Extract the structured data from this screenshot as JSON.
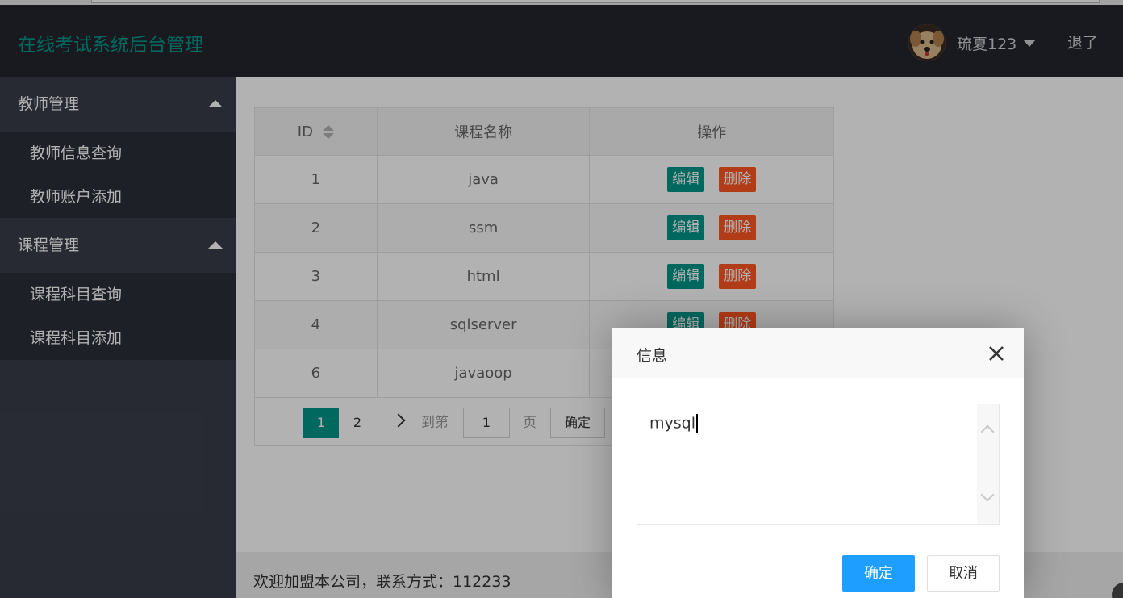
{
  "header": {
    "logo": "在线考试系统后台管理",
    "username": "琉夏123",
    "logout": "退了"
  },
  "sidebar": {
    "groups": [
      {
        "title": "教师管理",
        "items": [
          "教师信息查询",
          "教师账户添加"
        ]
      },
      {
        "title": "课程管理",
        "items": [
          "课程科目查询",
          "课程科目添加"
        ]
      }
    ]
  },
  "table": {
    "columns": [
      "ID",
      "课程名称",
      "操作"
    ],
    "rows": [
      {
        "id": "1",
        "name": "java"
      },
      {
        "id": "2",
        "name": "ssm"
      },
      {
        "id": "3",
        "name": "html"
      },
      {
        "id": "4",
        "name": "sqlserver"
      },
      {
        "id": "6",
        "name": "javaoop"
      }
    ],
    "edit_label": "编辑",
    "delete_label": "删除"
  },
  "pager": {
    "current": "1",
    "next_page": "2",
    "goto_label": "到第",
    "input_value": "1",
    "page_label": "页",
    "ok_label": "确定"
  },
  "footer": {
    "text": "欢迎加盟本公司，联系方式：112233"
  },
  "dialog": {
    "title": "信息",
    "value": "mysql",
    "ok_label": "确定",
    "cancel_label": "取消"
  },
  "colors": {
    "header_bg": "#23262e",
    "accent": "#009688",
    "danger": "#ff5722",
    "primary_btn": "#1e9fff"
  }
}
